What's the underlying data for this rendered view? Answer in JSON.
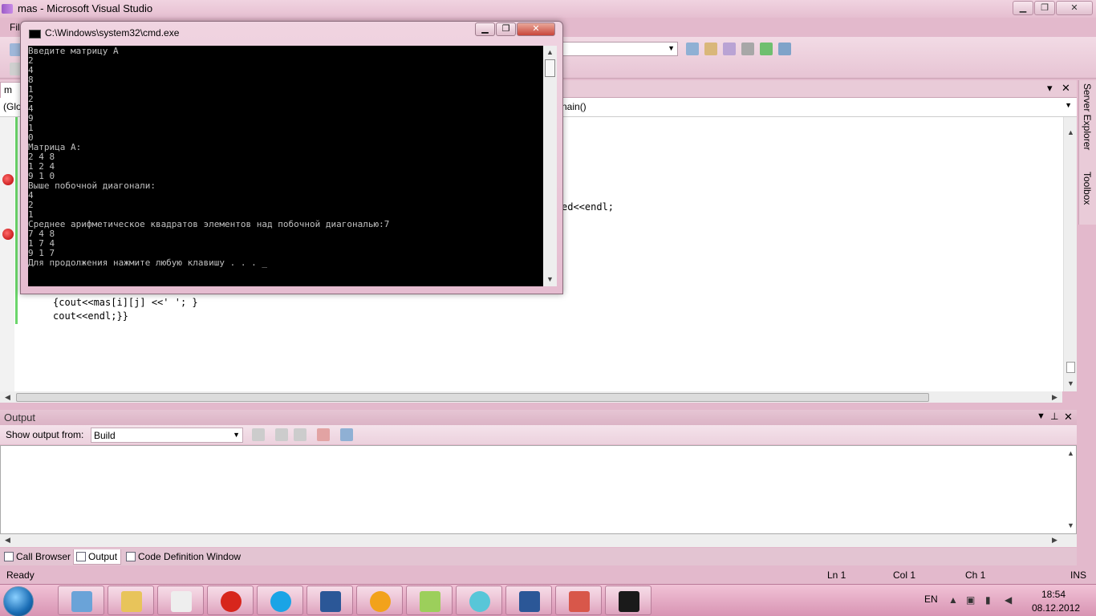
{
  "vs_window": {
    "title": "mas - Microsoft Visual Studio",
    "menu_partial": "Fil"
  },
  "editor": {
    "tab_partial": "m",
    "nav_left": "(Glo",
    "nav_right": "nain()",
    "code_lines": [
      "ed<<endl;",
      "{cout<<mas[i][j] <<' '; }",
      "cout<<endl;}}"
    ]
  },
  "cmd": {
    "title": "C:\\Windows\\system32\\cmd.exe",
    "lines": [
      "Введите матрицу А",
      "2",
      "4",
      "8",
      "1",
      "2",
      "4",
      "9",
      "1",
      "0",
      "Матрица А:",
      "2 4 8",
      "1 2 4",
      "9 1 0",
      "Выше побочной диагонали:",
      "4",
      "2",
      "1",
      "Среднее арифметическое квадратов элементов над побочной диагональю:7",
      "7 4 8",
      "1 7 4",
      "9 1 7",
      "Для продолжения нажмите любую клавишу . . . _"
    ]
  },
  "output_panel": {
    "title": "Output",
    "show_output_label": "Show output from:",
    "source": "Build"
  },
  "bottom_tabs": [
    "Call Browser",
    "Output",
    "Code Definition Window"
  ],
  "right_rail": [
    "Server Explorer",
    "Toolbox"
  ],
  "status": {
    "ready": "Ready",
    "ln": "Ln 1",
    "col": "Col 1",
    "ch": "Ch 1",
    "ins": "INS"
  },
  "taskbar": {
    "lang": "EN",
    "time": "18:54",
    "date": "08.12.2012",
    "apps": [
      "media-player-icon",
      "explorer-icon",
      "notepad-icon",
      "opera-icon",
      "skype-icon",
      "word-icon",
      "aimp-icon",
      "sticky-notes-icon",
      "cd-icon",
      "word2-icon",
      "visual-studio-icon",
      "cmd-icon"
    ]
  },
  "colors": {
    "theme_pink": "#e3b9cc",
    "console_bg": "#000000",
    "console_fg": "#c0c0c0"
  }
}
